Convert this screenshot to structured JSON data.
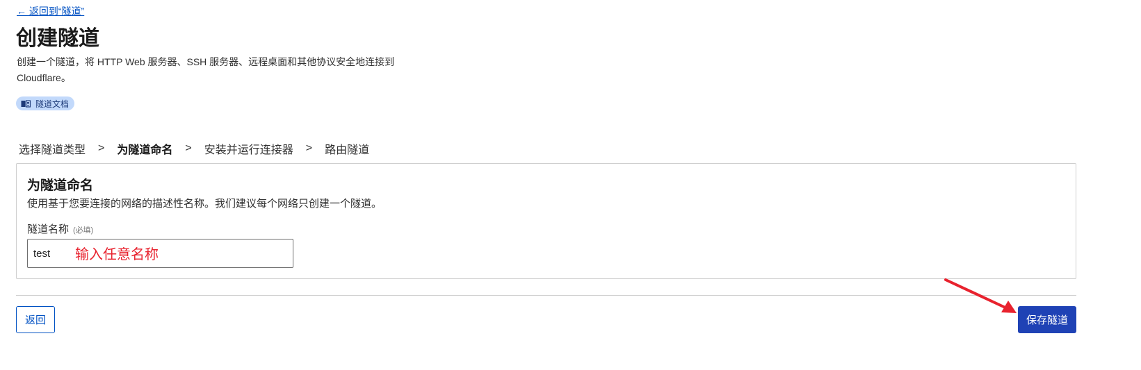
{
  "header": {
    "back_link": "← 返回到“隧道”",
    "title": "创建隧道",
    "description": "创建一个隧道，将 HTTP Web 服务器、SSH 服务器、远程桌面和其他协议安全地连接到 Cloudflare。",
    "docs_badge": "隧道文档",
    "docs_icon": "book-icon"
  },
  "steps": {
    "items": [
      {
        "label": "选择隧道类型",
        "active": false
      },
      {
        "label": "为隧道命名",
        "active": true
      },
      {
        "label": "安装并运行连接器",
        "active": false
      },
      {
        "label": "路由隧道",
        "active": false
      }
    ],
    "separator": ">"
  },
  "card": {
    "title": "为隧道命名",
    "description": "使用基于您要连接的网络的描述性名称。我们建议每个网络只创建一个隧道。",
    "field_label": "隧道名称",
    "field_required": "(必填)",
    "field_value": "test"
  },
  "annotation": {
    "text": "输入任意名称",
    "color": "#e8222e"
  },
  "footer": {
    "back_button": "返回",
    "save_button": "保存隧道"
  },
  "colors": {
    "link": "#0051c3",
    "primary_button": "#1f42b5",
    "badge_bg": "#c2d9fb"
  }
}
